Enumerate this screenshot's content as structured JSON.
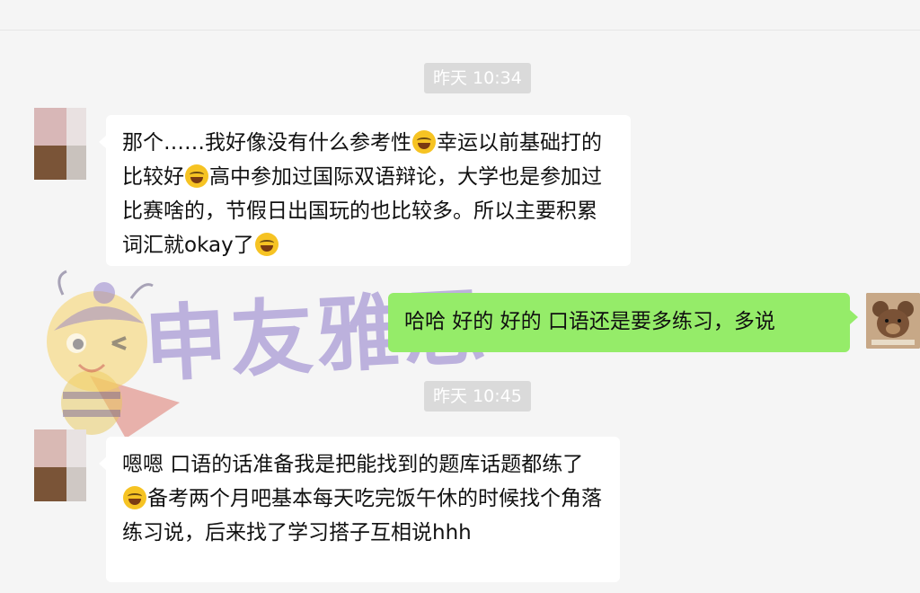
{
  "timestamps": [
    "昨天 10:34",
    "昨天 10:45"
  ],
  "messages": [
    {
      "sender": "other",
      "segments": [
        "那个……我好像没有什么参考性",
        "幸运以前基础打的比较好",
        "高中参加过国际双语辩论，大学也是参加过比赛啥的，节假日出国玩的也比较多。所以主要积累词汇就okay了",
        ""
      ],
      "emojis": [
        "cry-laugh-emoji",
        "laugh-emoji",
        "laugh-emoji"
      ]
    },
    {
      "sender": "me",
      "text": "哈哈 好的  好的 口语还是要多练习，多说"
    },
    {
      "sender": "other",
      "segments": [
        "嗯嗯 口语的话准备我是把能找到的题库话题都练了",
        "备考两个月吧基本每天吃完饭午休的时候找个角落练习说，后来找了学习搭子互相说hhh"
      ],
      "emojis": [
        "laugh-emoji"
      ]
    }
  ],
  "watermark": {
    "text": "申友雅思"
  },
  "colors": {
    "background": "#f5f5f5",
    "incoming_bubble": "#ffffff",
    "outgoing_bubble": "#95ec69",
    "timestamp_bg": "#dadada",
    "watermark": "#8c78c8"
  }
}
